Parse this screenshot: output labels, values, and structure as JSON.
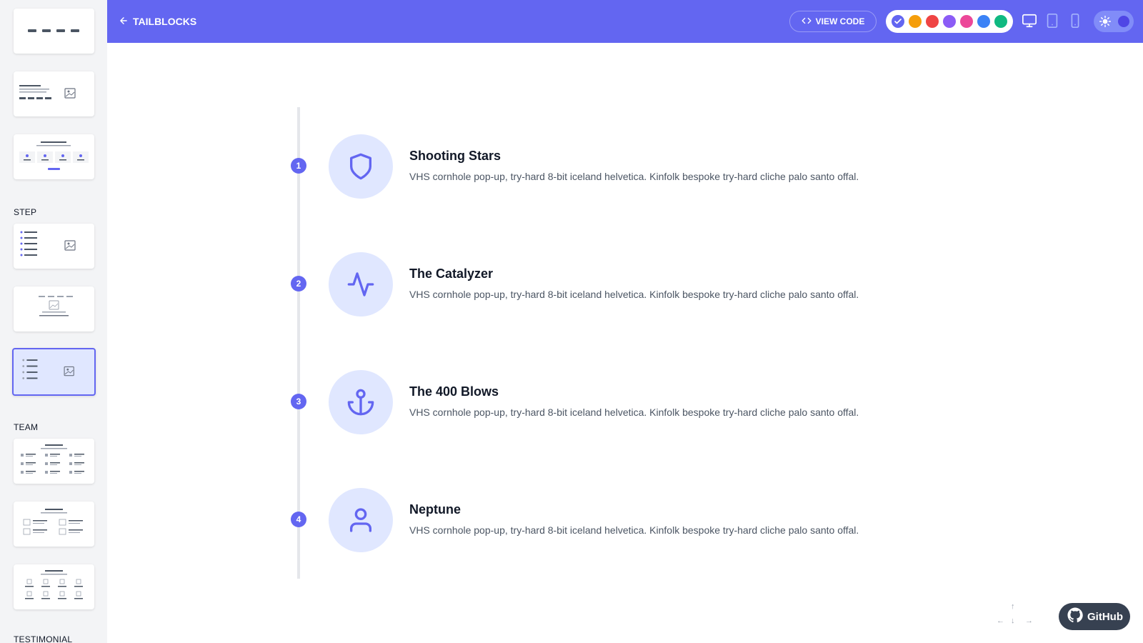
{
  "header": {
    "back_label": "TAILBLOCKS",
    "view_code_label": "VIEW CODE",
    "colors": [
      "#6366f1",
      "#f59e0b",
      "#ef4444",
      "#8b5cf6",
      "#ec4899",
      "#3b82f6",
      "#10b981"
    ],
    "selected_color": "#6366f1"
  },
  "sidebar": {
    "section_step": "STEP",
    "section_team": "TEAM",
    "section_testimonial": "TESTIMONIAL"
  },
  "steps": [
    {
      "number": "1",
      "title": "Shooting Stars",
      "desc": "VHS cornhole pop-up, try-hard 8-bit iceland helvetica. Kinfolk bespoke try-hard cliche palo santo offal.",
      "icon": "shield-icon"
    },
    {
      "number": "2",
      "title": "The Catalyzer",
      "desc": "VHS cornhole pop-up, try-hard 8-bit iceland helvetica. Kinfolk bespoke try-hard cliche palo santo offal.",
      "icon": "activity-icon"
    },
    {
      "number": "3",
      "title": "The 400 Blows",
      "desc": "VHS cornhole pop-up, try-hard 8-bit iceland helvetica. Kinfolk bespoke try-hard cliche palo santo offal.",
      "icon": "anchor-icon"
    },
    {
      "number": "4",
      "title": "Neptune",
      "desc": "VHS cornhole pop-up, try-hard 8-bit iceland helvetica. Kinfolk bespoke try-hard cliche palo santo offal.",
      "icon": "user-icon"
    }
  ],
  "footer": {
    "github_label": "GitHub"
  }
}
